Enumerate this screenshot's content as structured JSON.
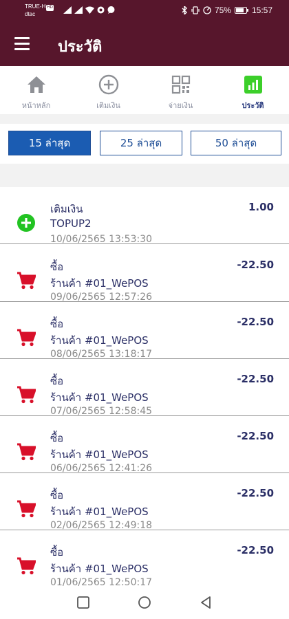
{
  "status_bar": {
    "carrier_top": "TRUE-H",
    "carrier_badge": "HD",
    "carrier_bottom": "dtac",
    "battery": "75%",
    "time": "15:57"
  },
  "header": {
    "title": "ประวัติ"
  },
  "tabs": [
    {
      "label": "หน้าหลัก",
      "icon": "home-icon"
    },
    {
      "label": "เติมเงิน",
      "icon": "plus-circle-icon"
    },
    {
      "label": "จ่ายเงิน",
      "icon": "qr-code-icon"
    },
    {
      "label": "ประวัติ",
      "icon": "bar-chart-icon"
    }
  ],
  "active_tab": "ประวัติ",
  "filters": [
    {
      "label": "15 ล่าสุด"
    },
    {
      "label": "25 ล่าสุด"
    },
    {
      "label": "50 ล่าสุด"
    }
  ],
  "active_filter": "15 ล่าสุด",
  "transactions": [
    {
      "type": "เติมเงิน",
      "name": "TOPUP2",
      "datetime": "10/06/2565 13:53:30",
      "amount": "1.00",
      "icon": "topup-plus-icon"
    },
    {
      "type": "ซื้อ",
      "name": "ร้านค้า #01_WePOS",
      "datetime": "09/06/2565 12:57:26",
      "amount": "-22.50",
      "icon": "cart-icon"
    },
    {
      "type": "ซื้อ",
      "name": "ร้านค้า #01_WePOS",
      "datetime": "08/06/2565 13:18:17",
      "amount": "-22.50",
      "icon": "cart-icon"
    },
    {
      "type": "ซื้อ",
      "name": "ร้านค้า #01_WePOS",
      "datetime": "07/06/2565 12:58:45",
      "amount": "-22.50",
      "icon": "cart-icon"
    },
    {
      "type": "ซื้อ",
      "name": "ร้านค้า #01_WePOS",
      "datetime": "06/06/2565 12:41:26",
      "amount": "-22.50",
      "icon": "cart-icon"
    },
    {
      "type": "ซื้อ",
      "name": "ร้านค้า #01_WePOS",
      "datetime": "02/06/2565 12:49:18",
      "amount": "-22.50",
      "icon": "cart-icon"
    },
    {
      "type": "ซื้อ",
      "name": "ร้านค้า #01_WePOS",
      "datetime": "01/06/2565 12:50:17",
      "amount": "-22.50",
      "icon": "cart-icon"
    }
  ],
  "colors": {
    "brand": "#57162c",
    "accent": "#1b5cb2",
    "topup_green": "#22c322",
    "cart_red": "#d8102a",
    "active_tab_green": "#3ccf2a"
  }
}
